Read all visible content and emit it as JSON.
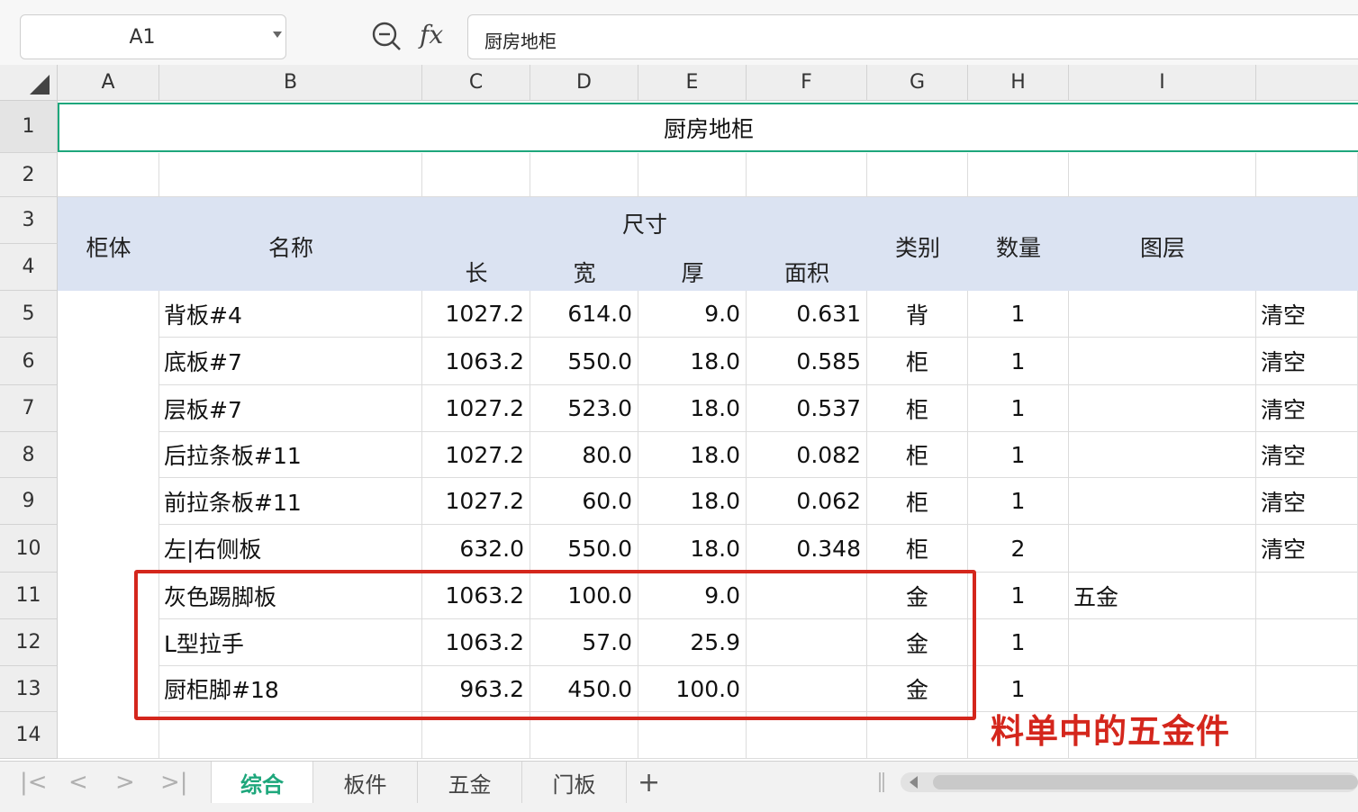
{
  "formula_bar": {
    "name_box": "A1",
    "formula": "厨房地柜"
  },
  "columns": [
    "A",
    "B",
    "C",
    "D",
    "E",
    "F",
    "G",
    "H",
    "I"
  ],
  "rows": [
    "1",
    "2",
    "3",
    "4",
    "5",
    "6",
    "7",
    "8",
    "9",
    "10",
    "11",
    "12",
    "13",
    "14"
  ],
  "title": "厨房地柜",
  "header": {
    "cabinet": "柜体",
    "name": "名称",
    "size": "尺寸",
    "length": "长",
    "width": "宽",
    "thickness": "厚",
    "area": "面积",
    "category": "类别",
    "quantity": "数量",
    "layer": "图层"
  },
  "data_rows": [
    {
      "name": "背板#4",
      "length": "1027.2",
      "width": "614.0",
      "thickness": "9.0",
      "area": "0.631",
      "category": "背",
      "quantity": "1",
      "layer": "",
      "extra": "清空"
    },
    {
      "name": "底板#7",
      "length": "1063.2",
      "width": "550.0",
      "thickness": "18.0",
      "area": "0.585",
      "category": "柜",
      "quantity": "1",
      "layer": "",
      "extra": "清空"
    },
    {
      "name": "层板#7",
      "length": "1027.2",
      "width": "523.0",
      "thickness": "18.0",
      "area": "0.537",
      "category": "柜",
      "quantity": "1",
      "layer": "",
      "extra": "清空"
    },
    {
      "name": "后拉条板#11",
      "length": "1027.2",
      "width": "80.0",
      "thickness": "18.0",
      "area": "0.082",
      "category": "柜",
      "quantity": "1",
      "layer": "",
      "extra": "清空"
    },
    {
      "name": "前拉条板#11",
      "length": "1027.2",
      "width": "60.0",
      "thickness": "18.0",
      "area": "0.062",
      "category": "柜",
      "quantity": "1",
      "layer": "",
      "extra": "清空"
    },
    {
      "name": "左|右侧板",
      "length": "632.0",
      "width": "550.0",
      "thickness": "18.0",
      "area": "0.348",
      "category": "柜",
      "quantity": "2",
      "layer": "",
      "extra": "清空"
    },
    {
      "name": "灰色踢脚板",
      "length": "1063.2",
      "width": "100.0",
      "thickness": "9.0",
      "area": "",
      "category": "金",
      "quantity": "1",
      "layer": "五金",
      "extra": ""
    },
    {
      "name": "L型拉手",
      "length": "1063.2",
      "width": "57.0",
      "thickness": "25.9",
      "area": "",
      "category": "金",
      "quantity": "1",
      "layer": "",
      "extra": ""
    },
    {
      "name": "厨柜脚#18",
      "length": "963.2",
      "width": "450.0",
      "thickness": "100.0",
      "area": "",
      "category": "金",
      "quantity": "1",
      "layer": "",
      "extra": ""
    }
  ],
  "annotation": "料单中的五金件",
  "sheet_tabs": [
    "综合",
    "板件",
    "五金",
    "门板"
  ],
  "add_sheet": "+",
  "nav": {
    "first": "|<",
    "prev": "<",
    "next": ">",
    "last": ">|"
  },
  "colors": {
    "accent": "#1ea77c",
    "header_fill": "#dbe3f2",
    "annotation": "#d4261c"
  }
}
